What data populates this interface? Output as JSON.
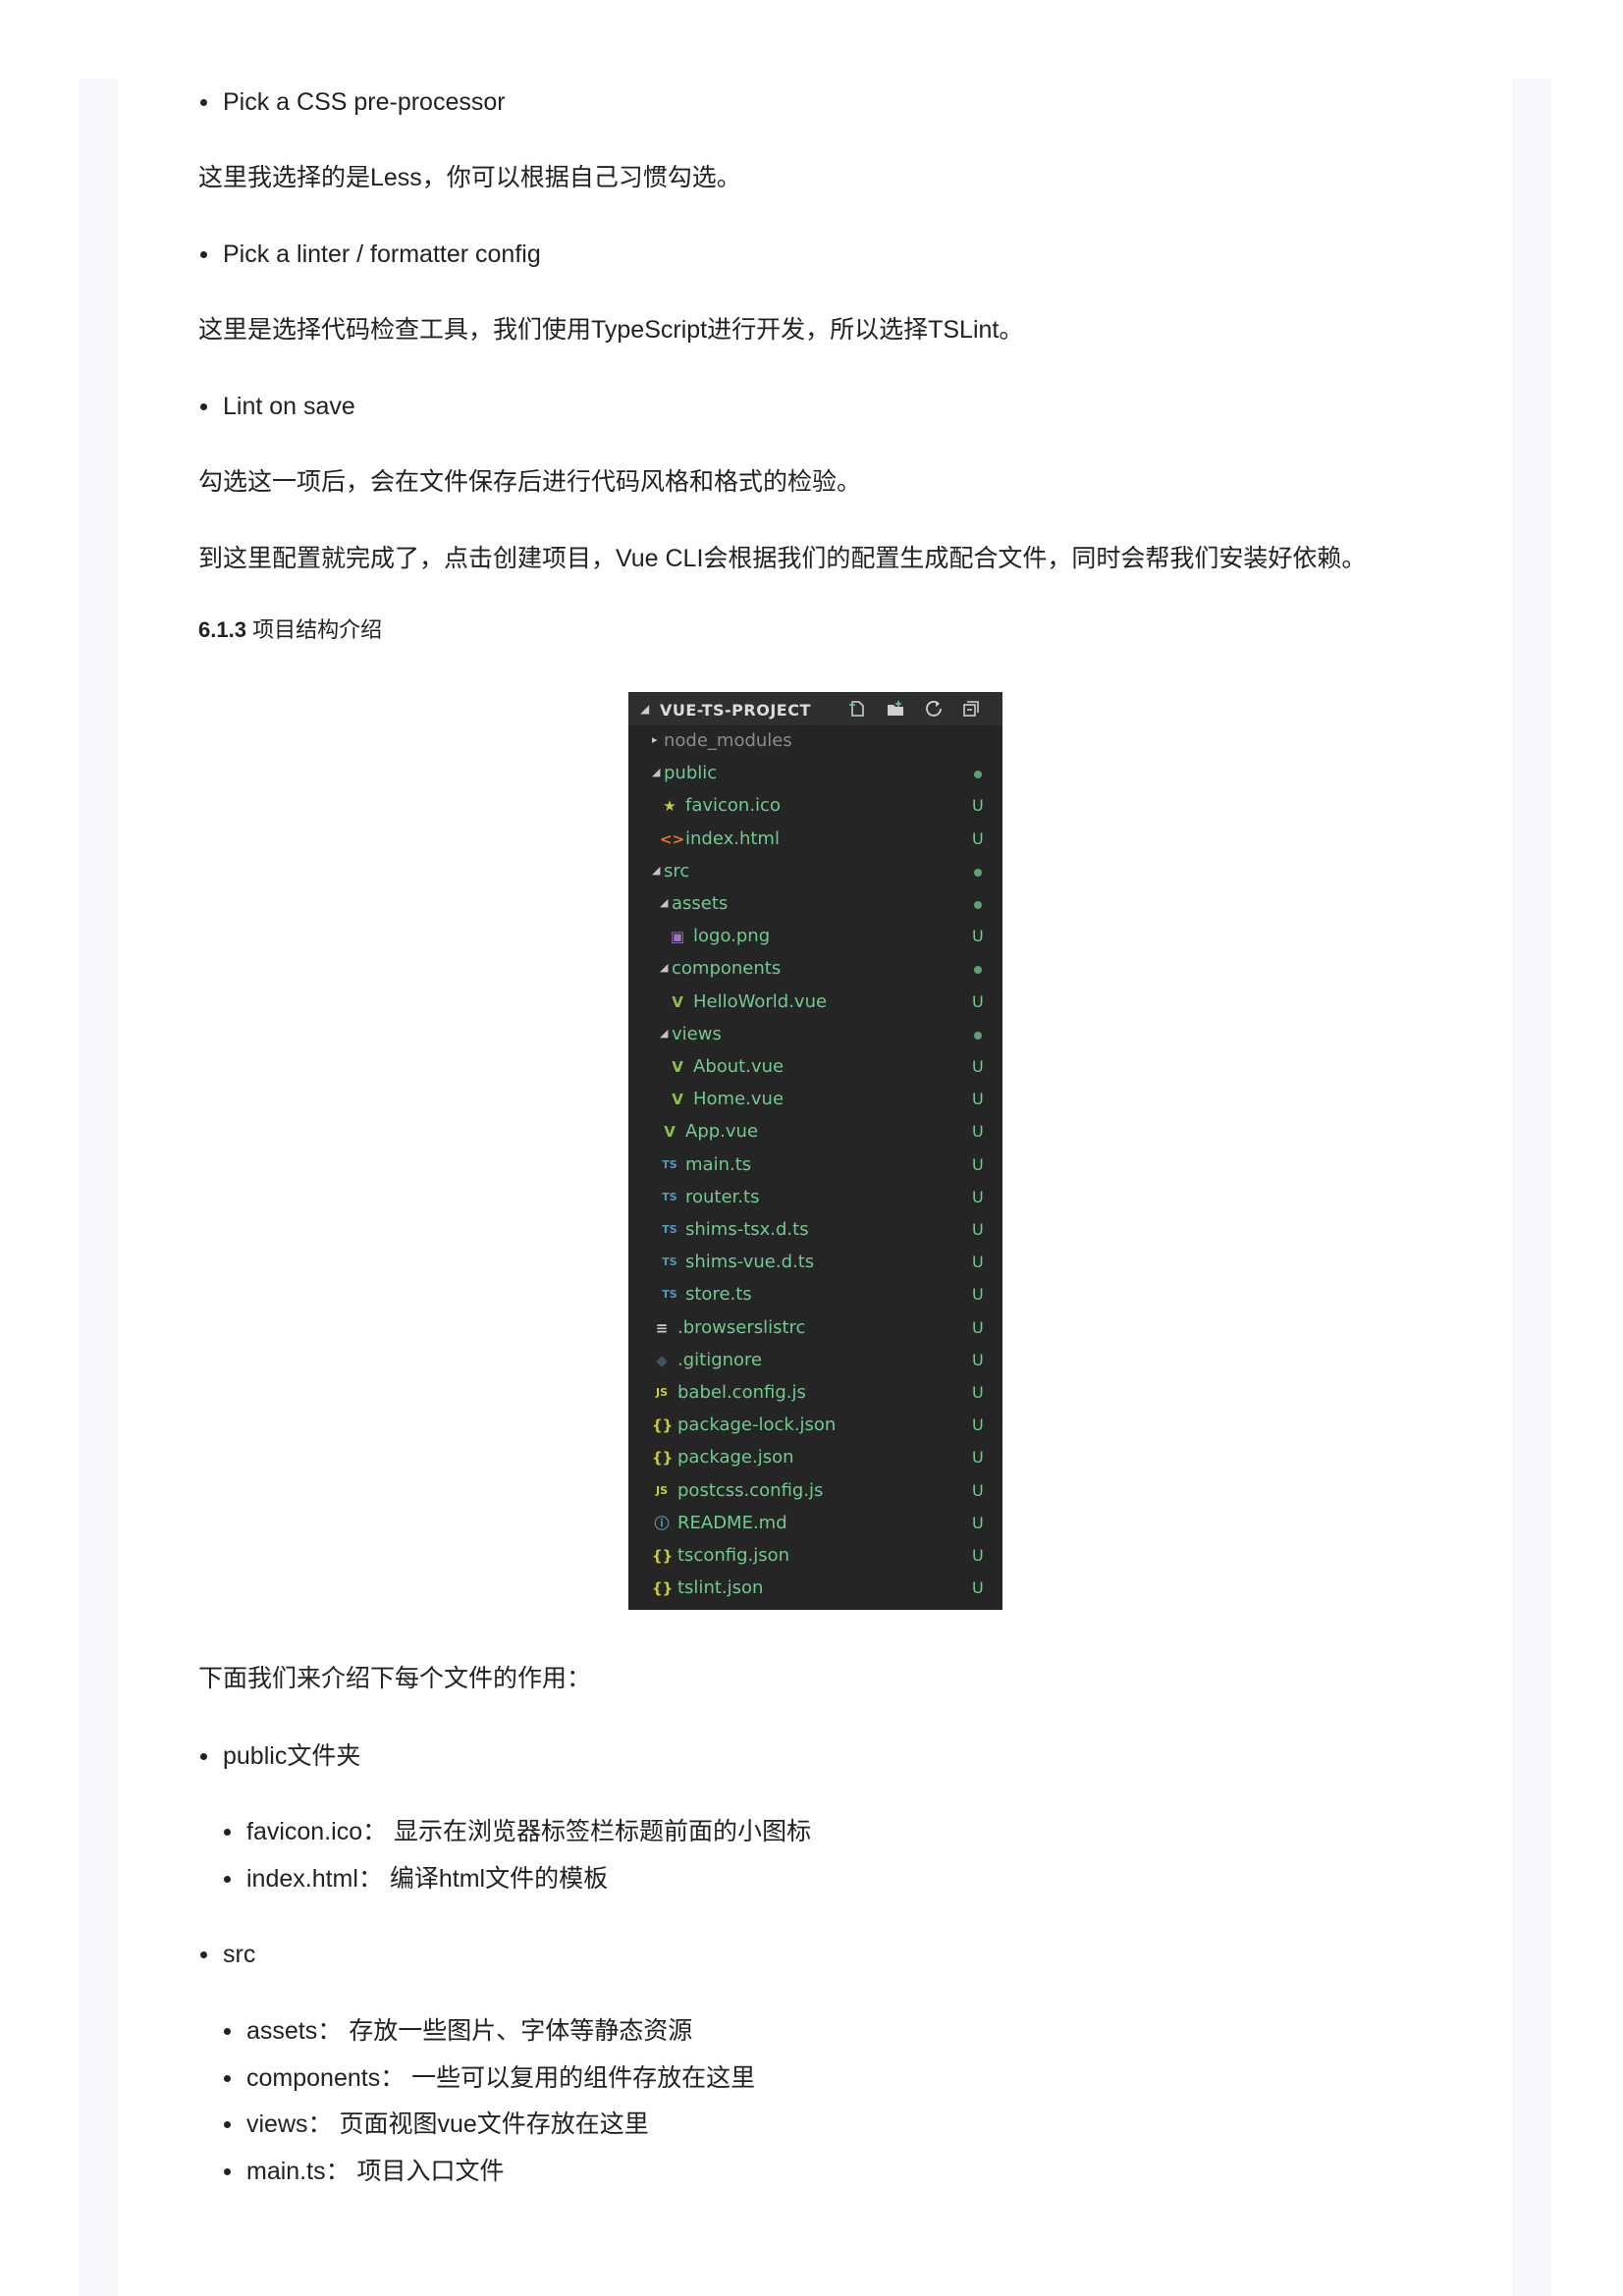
{
  "intro": {
    "bullet_css": "Pick a CSS pre-processor",
    "para_css": "这里我选择的是Less，你可以根据自己习惯勾选。",
    "bullet_linter": "Pick a linter / formatter config",
    "para_linter": "这里是选择代码检查工具，我们使用TypeScript进行开发，所以选择TSLint。",
    "bullet_lint_save": "Lint on save",
    "para_lint_save": "勾选这一项后，会在文件保存后进行代码风格和格式的检验。",
    "para_done": "到这里配置就完成了，点击创建项目，Vue CLI会根据我们的配置生成配合文件，同时会帮我们安装好依赖。"
  },
  "section": {
    "number": "6.1.3",
    "title": "项目结构介绍"
  },
  "explorer": {
    "title": "VUE-TS-PROJECT",
    "colors": {
      "vue": "#41b883",
      "ts": "#519aba",
      "json": "#cbcb41",
      "folder": "#73c991",
      "untracked": "#73c991"
    },
    "items": [
      {
        "label": "node_modules",
        "twist": "▸",
        "icon": "",
        "status": "",
        "color": "#8c8c8c"
      },
      {
        "label": "public",
        "twist": "◢",
        "icon": "",
        "status": "dot",
        "color": "#73c991"
      },
      {
        "label": "favicon.ico",
        "twist": "",
        "icon": "★",
        "icon_name": "star-icon",
        "icon_color": "#cbcb41",
        "status": "U",
        "color": "#73c991"
      },
      {
        "label": "index.html",
        "twist": "",
        "icon": "<>",
        "icon_name": "html-icon",
        "icon_color": "#e37933",
        "status": "U",
        "color": "#73c991"
      },
      {
        "label": "src",
        "twist": "◢",
        "icon": "",
        "status": "dot",
        "color": "#73c991"
      },
      {
        "label": "assets",
        "twist": "◢",
        "icon": "",
        "status": "dot",
        "color": "#73c991"
      },
      {
        "label": "logo.png",
        "twist": "",
        "icon": "▣",
        "icon_name": "image-icon",
        "icon_color": "#a074c4",
        "status": "U",
        "color": "#73c991"
      },
      {
        "label": "components",
        "twist": "◢",
        "icon": "",
        "status": "dot",
        "color": "#73c991"
      },
      {
        "label": "HelloWorld.vue",
        "twist": "",
        "icon": "V",
        "icon_name": "vue-icon",
        "icon_color": "#8dc149",
        "status": "U",
        "color": "#73c991"
      },
      {
        "label": "views",
        "twist": "◢",
        "icon": "",
        "status": "dot",
        "color": "#73c991"
      },
      {
        "label": "About.vue",
        "twist": "",
        "icon": "V",
        "icon_name": "vue-icon",
        "icon_color": "#8dc149",
        "status": "U",
        "color": "#73c991"
      },
      {
        "label": "Home.vue",
        "twist": "",
        "icon": "V",
        "icon_name": "vue-icon",
        "icon_color": "#8dc149",
        "status": "U",
        "color": "#73c991"
      },
      {
        "label": "App.vue",
        "twist": "",
        "icon": "V",
        "icon_name": "vue-icon",
        "icon_color": "#8dc149",
        "status": "U",
        "color": "#73c991"
      },
      {
        "label": "main.ts",
        "twist": "",
        "icon": "TS",
        "icon_name": "typescript-icon",
        "icon_color": "#519aba",
        "status": "U",
        "color": "#73c991"
      },
      {
        "label": "router.ts",
        "twist": "",
        "icon": "TS",
        "icon_name": "typescript-icon",
        "icon_color": "#519aba",
        "status": "U",
        "color": "#73c991"
      },
      {
        "label": "shims-tsx.d.ts",
        "twist": "",
        "icon": "TS",
        "icon_name": "typescript-icon",
        "icon_color": "#519aba",
        "status": "U",
        "color": "#73c991"
      },
      {
        "label": "shims-vue.d.ts",
        "twist": "",
        "icon": "TS",
        "icon_name": "typescript-icon",
        "icon_color": "#519aba",
        "status": "U",
        "color": "#73c991"
      },
      {
        "label": "store.ts",
        "twist": "",
        "icon": "TS",
        "icon_name": "typescript-icon",
        "icon_color": "#519aba",
        "status": "U",
        "color": "#73c991"
      },
      {
        "label": ".browserslistrc",
        "twist": "",
        "icon": "≡",
        "icon_name": "config-icon",
        "icon_color": "#cccccc",
        "status": "U",
        "color": "#73c991"
      },
      {
        "label": ".gitignore",
        "twist": "",
        "icon": "◆",
        "icon_name": "git-icon",
        "icon_color": "#41535b",
        "status": "U",
        "color": "#73c991"
      },
      {
        "label": "babel.config.js",
        "twist": "",
        "icon": "JS",
        "icon_name": "javascript-icon",
        "icon_color": "#cbcb41",
        "status": "U",
        "color": "#73c991"
      },
      {
        "label": "package-lock.json",
        "twist": "",
        "icon": "{}",
        "icon_name": "json-icon",
        "icon_color": "#cbcb41",
        "status": "U",
        "color": "#73c991"
      },
      {
        "label": "package.json",
        "twist": "",
        "icon": "{}",
        "icon_name": "json-icon",
        "icon_color": "#cbcb41",
        "status": "U",
        "color": "#73c991"
      },
      {
        "label": "postcss.config.js",
        "twist": "",
        "icon": "JS",
        "icon_name": "javascript-icon",
        "icon_color": "#cbcb41",
        "status": "U",
        "color": "#73c991"
      },
      {
        "label": "README.md",
        "twist": "",
        "icon": "ⓘ",
        "icon_name": "info-icon",
        "icon_color": "#519aba",
        "status": "U",
        "color": "#73c991"
      },
      {
        "label": "tsconfig.json",
        "twist": "",
        "icon": "{}",
        "icon_name": "json-icon",
        "icon_color": "#cbcb41",
        "status": "U",
        "color": "#73c991"
      },
      {
        "label": "tslint.json",
        "twist": "",
        "icon": "{}",
        "icon_name": "json-icon",
        "icon_color": "#cbcb41",
        "status": "U",
        "color": "#73c991"
      }
    ]
  },
  "explain": {
    "intro": "下面我们来介绍下每个文件的作用：",
    "public_label": "public文件夹",
    "public_items": [
      "favicon.ico： 显示在浏览器标签栏标题前面的小图标",
      "index.html： 编译html文件的模板"
    ],
    "src_label": "src",
    "src_items": [
      "assets： 存放一些图片、字体等静态资源",
      "components： 一些可以复用的组件存放在这里",
      "views： 页面视图vue文件存放在这里",
      "main.ts： 项目入口文件"
    ]
  }
}
